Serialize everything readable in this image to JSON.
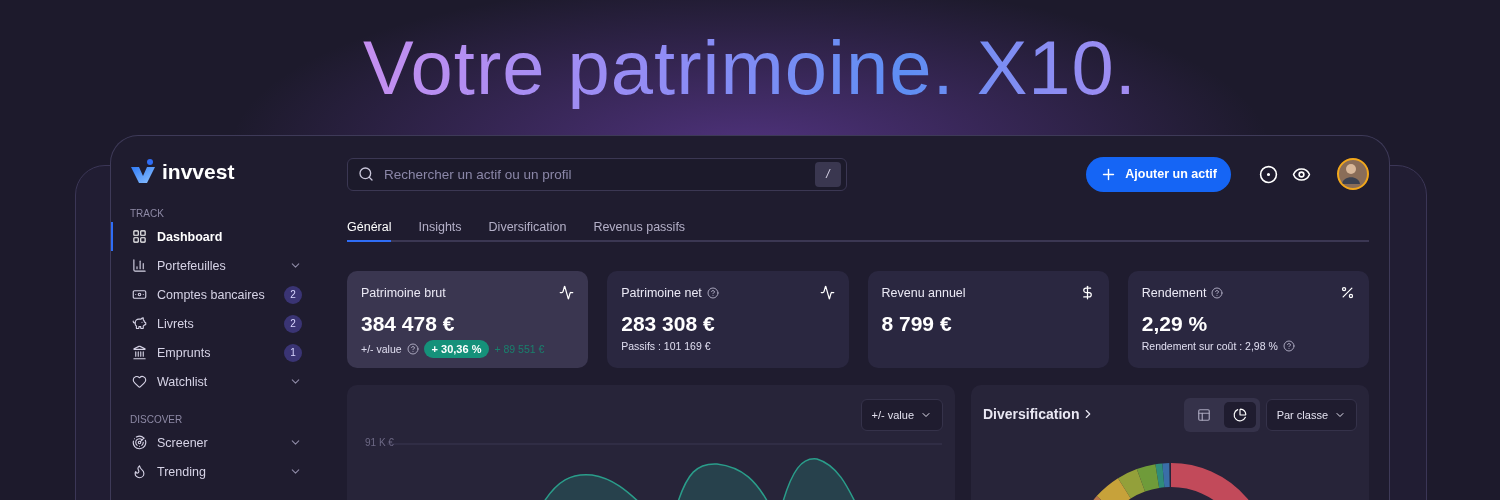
{
  "headline": "Votre patrimoine. X10.",
  "brand": "invvest",
  "sidebar": {
    "sections": [
      {
        "title": "TRACK",
        "items": [
          {
            "label": "Dashboard",
            "selected": true,
            "has_submenu": false
          },
          {
            "label": "Portefeuilles",
            "selected": false,
            "has_submenu": true
          },
          {
            "label": "Comptes bancaires",
            "selected": false,
            "has_submenu": false,
            "badge": "2"
          },
          {
            "label": "Livrets",
            "selected": false,
            "has_submenu": false,
            "badge": "2"
          },
          {
            "label": "Emprunts",
            "selected": false,
            "has_submenu": false,
            "badge": "1"
          },
          {
            "label": "Watchlist",
            "selected": false,
            "has_submenu": true
          }
        ]
      },
      {
        "title": "DISCOVER",
        "items": [
          {
            "label": "Screener",
            "selected": false,
            "has_submenu": true
          },
          {
            "label": "Trending",
            "selected": false,
            "has_submenu": true
          }
        ]
      }
    ]
  },
  "search": {
    "placeholder": "Rechercher un actif ou un profil",
    "shortcut": "/"
  },
  "add_button": "Ajouter un actif",
  "tabs": [
    {
      "label": "Général",
      "selected": true
    },
    {
      "label": "Insights",
      "selected": false
    },
    {
      "label": "Diversification",
      "selected": false
    },
    {
      "label": "Revenus passifs",
      "selected": false
    }
  ],
  "cards": [
    {
      "title": "Patrimoine brut",
      "help": false,
      "value": "384 478 €",
      "selected": true,
      "footer": {
        "kind": "gain",
        "label": "+/- value",
        "help": true,
        "badge": "+ 30,36 %",
        "amount": "+ 89 551 €"
      }
    },
    {
      "title": "Patrimoine net",
      "help": true,
      "value": "283 308 €",
      "selected": false,
      "footer": {
        "kind": "text",
        "text": "Passifs : 101 169 €",
        "help": false
      }
    },
    {
      "title": "Revenu annuel",
      "help": false,
      "value": "8 799 €",
      "selected": false
    },
    {
      "title": "Rendement",
      "help": true,
      "value": "2,29 %",
      "selected": false,
      "footer": {
        "kind": "text",
        "text": "Rendement sur coût : 2,98 %",
        "help": true
      }
    }
  ],
  "chart_panel": {
    "dropdown": "+/- value",
    "y_label": "91 K €"
  },
  "diversification": {
    "title": "Diversification",
    "views": [
      {
        "selected": false
      },
      {
        "selected": true
      }
    ],
    "dropdown": "Par classe"
  }
}
